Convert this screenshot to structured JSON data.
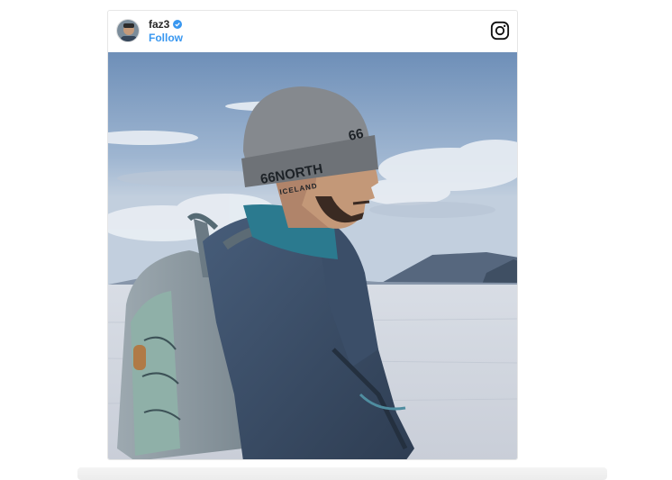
{
  "post": {
    "username": "faz3",
    "verified": true,
    "follow_label": "Follow",
    "brand_icon": "instagram-icon"
  },
  "photo": {
    "beanie_text_top": "66",
    "beanie_text_bottom": "66NORTH",
    "beanie_text_line2": "ICELAND"
  },
  "colors": {
    "follow_blue": "#3897f0",
    "verified_blue": "#3897f0",
    "sky": "#7f9cc0",
    "snow": "#d9dde3"
  }
}
